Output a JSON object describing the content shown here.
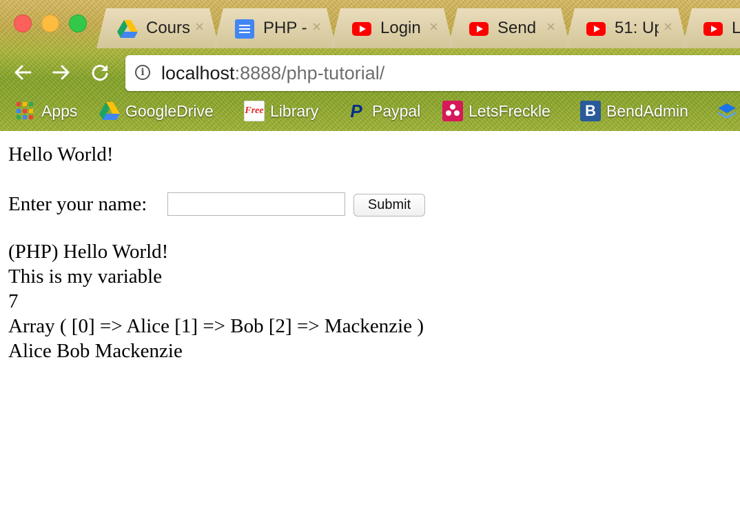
{
  "browser": {
    "tabs": [
      {
        "label": "Cours",
        "icon": "google-drive-icon"
      },
      {
        "label": "PHP -",
        "icon": "google-docs-icon"
      },
      {
        "label": "Login",
        "icon": "youtube-icon"
      },
      {
        "label": "Send",
        "icon": "youtube-icon"
      },
      {
        "label": "51: Up",
        "icon": "youtube-icon"
      },
      {
        "label": "L",
        "icon": "youtube-icon"
      }
    ],
    "tab_close": "×",
    "address_host": "localhost",
    "address_rest": ":8888/php-tutorial/",
    "bookmarks": [
      {
        "label": "Apps",
        "icon": "apps-grid-icon"
      },
      {
        "label": "GoogleDrive",
        "icon": "google-drive-icon"
      },
      {
        "label": "Library",
        "icon": "free-library-icon"
      },
      {
        "label": "Paypal",
        "icon": "paypal-icon"
      },
      {
        "label": "LetsFreckle",
        "icon": "letsfreckle-icon"
      },
      {
        "label": "BendAdmin",
        "icon": "bendadmin-icon"
      }
    ],
    "icons": {
      "free_badge": "Free",
      "paypal_letter": "P",
      "bend_letter": "B"
    }
  },
  "page": {
    "heading": "Hello World!",
    "form": {
      "label": "Enter your name:",
      "input_value": "",
      "submit_label": "Submit"
    },
    "output_lines": [
      "(PHP) Hello World!",
      "This is my variable",
      "7",
      "Array ( [0] => Alice [1] => Bob [2] => Mackenzie )",
      "Alice Bob Mackenzie"
    ]
  }
}
